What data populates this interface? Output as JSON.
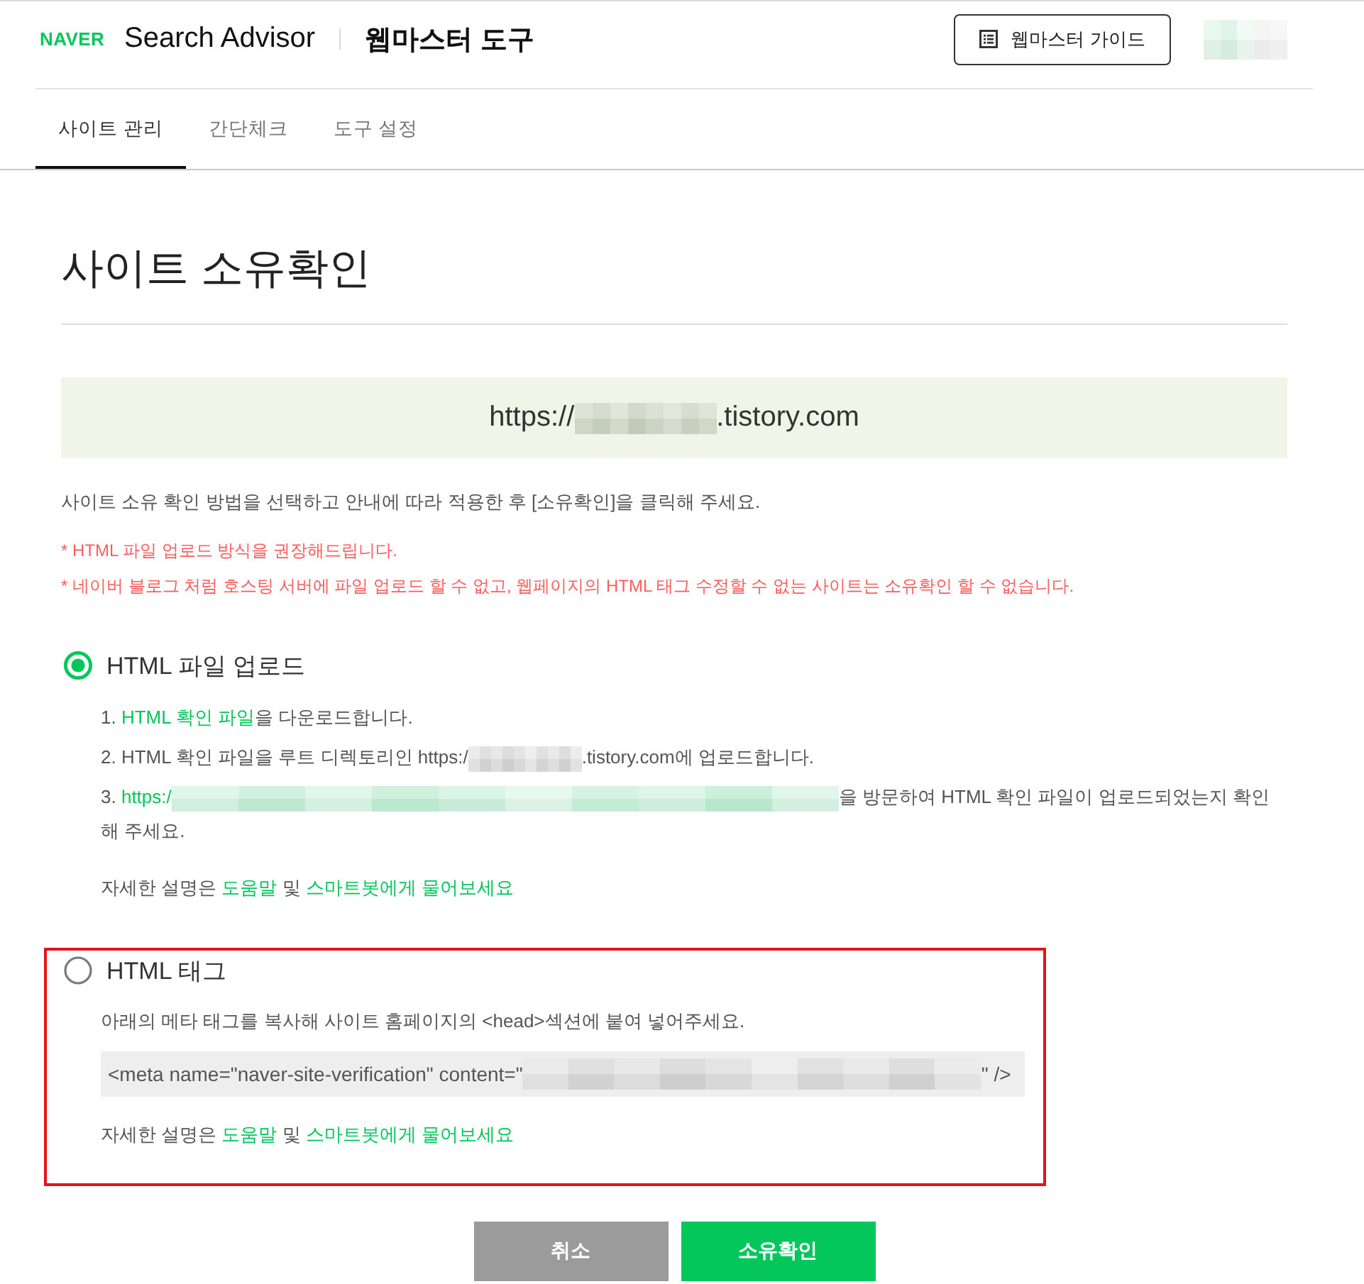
{
  "header": {
    "logo": "NAVER",
    "product": "Search Advisor",
    "tool": "웹마스터 도구",
    "guide_button": "웹마스터 가이드"
  },
  "tabs": [
    {
      "label": "사이트 관리",
      "selected": true
    },
    {
      "label": "간단체크",
      "selected": false
    },
    {
      "label": "도구 설정",
      "selected": false
    }
  ],
  "page_title": "사이트 소유확인",
  "site_url": [
    {
      "kind": "text",
      "text": "https://"
    },
    {
      "kind": "redacted"
    },
    {
      "kind": "text",
      "text": ".tistory.com"
    }
  ],
  "instruction": "사이트 소유 확인 방법을 선택하고 안내에 따라 적용한 후 [소유확인]을 클릭해 주세요.",
  "notes": [
    "* HTML 파일 업로드 방식을 권장해드립니다.",
    "* 네이버 블로그 처럼 호스팅 서버에 파일 업로드 할 수 없고, 웹페이지의 HTML 태그 수정할 수 없는 사이트는 소유확인 할 수 없습니다."
  ],
  "options": [
    {
      "kind": "file_upload",
      "label": "HTML 파일 업로드",
      "selected": true,
      "highlighted": false,
      "steps": [
        [
          {
            "kind": "text",
            "text": "1. "
          },
          {
            "kind": "link",
            "text": "HTML 확인 파일"
          },
          {
            "kind": "text",
            "text": "을 다운로드합니다."
          }
        ],
        [
          {
            "kind": "text",
            "text": "2. HTML 확인 파일을 루트 디렉토리인 https:/"
          },
          {
            "kind": "redacted"
          },
          {
            "kind": "text",
            "text": ".tistory.com에 업로드합니다."
          }
        ],
        [
          {
            "kind": "text",
            "text": "3. "
          },
          {
            "kind": "link",
            "text": "https:/"
          },
          {
            "kind": "redacted_link"
          },
          {
            "kind": "text",
            "text": "을 방문하여 HTML 확인 파일이 업로드되었는지 확인 해 주세요."
          }
        ]
      ],
      "help": [
        {
          "kind": "text",
          "text": "자세한 설명은 "
        },
        {
          "kind": "link",
          "text": "도움말"
        },
        {
          "kind": "text",
          "text": " 및 "
        },
        {
          "kind": "link",
          "text": "스마트봇에게 물어보세요"
        }
      ]
    },
    {
      "kind": "meta_tag",
      "label": "HTML 태그",
      "selected": false,
      "highlighted": true,
      "instruction": "아래의 메타 태그를 복사해 사이트 홈페이지의 <head>섹션에 붙여 넣어주세요.",
      "code": [
        {
          "kind": "text",
          "text": "<meta name=\"naver-site-verification\" content=\""
        },
        {
          "kind": "redacted"
        },
        {
          "kind": "text",
          "text": "\" />"
        }
      ],
      "help": [
        {
          "kind": "text",
          "text": "자세한 설명은 "
        },
        {
          "kind": "link",
          "text": "도움말"
        },
        {
          "kind": "text",
          "text": " 및 "
        },
        {
          "kind": "link",
          "text": "스마트봇에게 물어보세요"
        }
      ]
    }
  ],
  "buttons": [
    {
      "kind": "cancel",
      "label": "취소"
    },
    {
      "kind": "confirm",
      "label": "소유확인"
    }
  ]
}
